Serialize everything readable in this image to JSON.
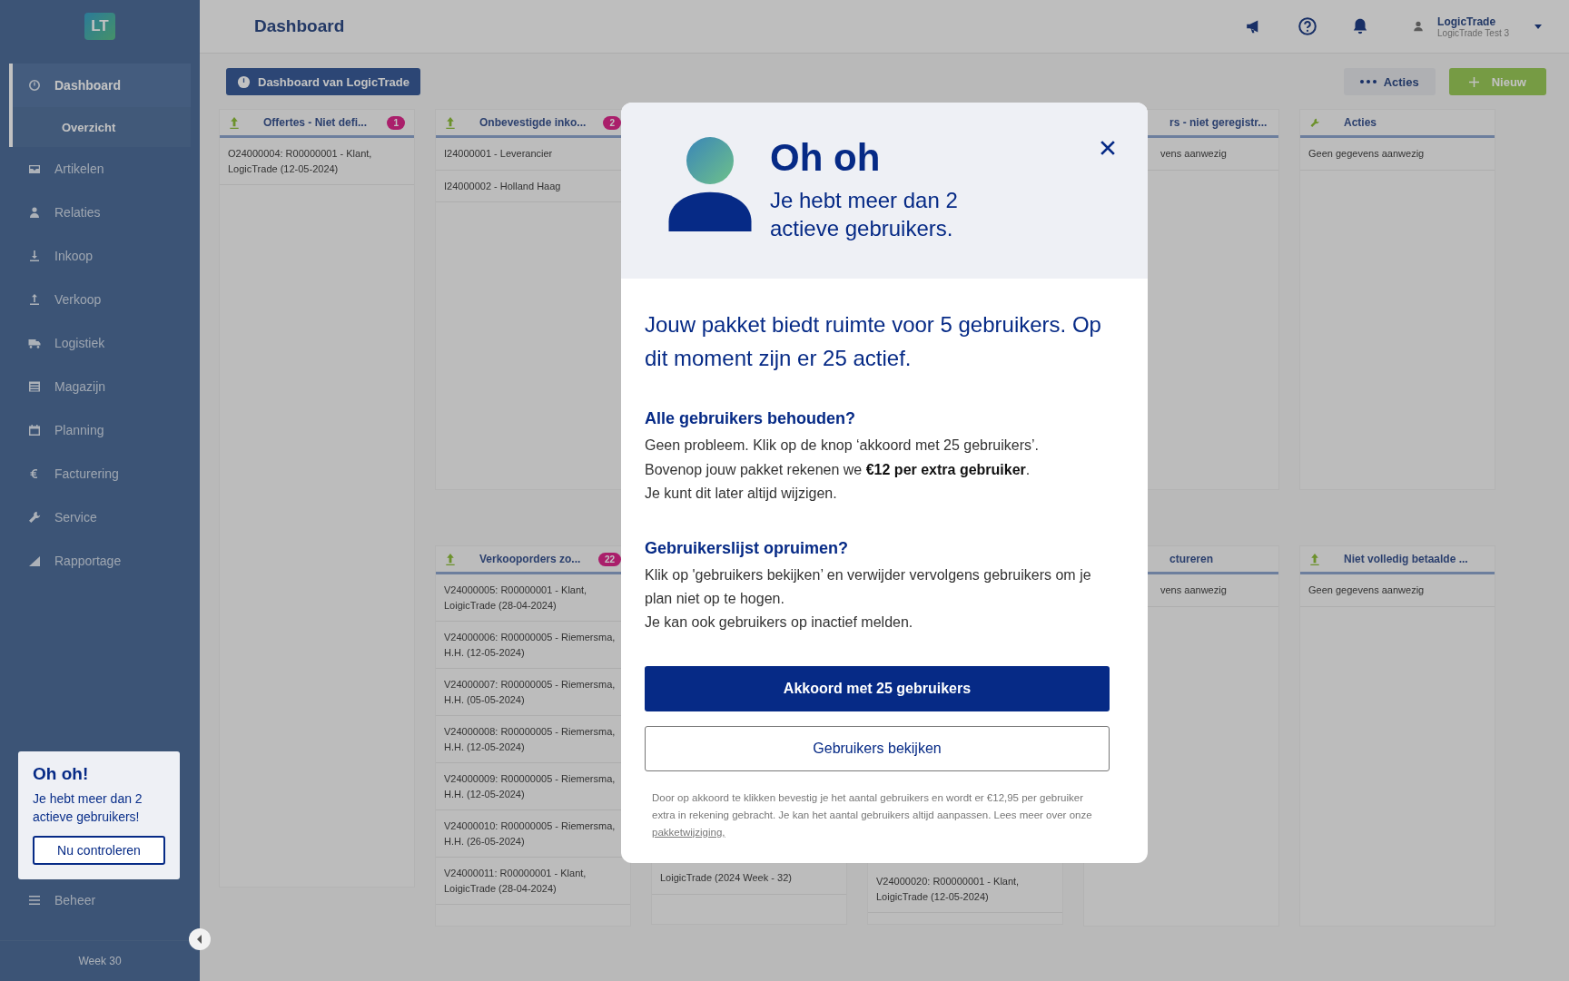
{
  "sidebar": {
    "logo": "LT",
    "items": [
      {
        "label": "Dashboard",
        "selected": true,
        "children": [
          {
            "label": "Overzicht",
            "selected": true
          }
        ]
      },
      {
        "label": "Artikelen",
        "selected": false
      },
      {
        "label": "Relaties",
        "selected": false
      },
      {
        "label": "Inkoop",
        "selected": false
      },
      {
        "label": "Verkoop",
        "selected": false
      },
      {
        "label": "Logistiek",
        "selected": false
      },
      {
        "label": "Magazijn",
        "selected": false
      },
      {
        "label": "Planning",
        "selected": false
      },
      {
        "label": "Facturering",
        "selected": false
      },
      {
        "label": "Service",
        "selected": false
      },
      {
        "label": "Rapportage",
        "selected": false
      }
    ],
    "footer_item": {
      "label": "Beheer",
      "selected": false
    },
    "week": "Week 30"
  },
  "header": {
    "title": "Dashboard",
    "user": {
      "name": "LogicTrade",
      "company": "LogicTrade Test 3"
    }
  },
  "toolbar": {
    "dashboard_button": "Dashboard van LogicTrade",
    "actions_button": "Acties",
    "new_button": "Nieuw"
  },
  "board": {
    "lanes": [
      {
        "cards": [
          {
            "kind": "arrow",
            "title": "Offertes - Niet defi...",
            "count": "1",
            "items": [
              "O24000004: R00000001 - Klant, LogicTrade (12-05-2024)"
            ]
          }
        ]
      },
      {
        "cards": [
          {
            "kind": "arrow",
            "title": "Onbevestigde inko...",
            "count": "2",
            "items": [
              "I24000001 - Leverancier",
              "I24000002 - Holland Haag"
            ]
          },
          {
            "kind": "arrow",
            "title": "Verkooporders zo...",
            "count": "22",
            "items": [
              "V24000005: R00000001 - Klant, LoigicTrade (28-04-2024)",
              "V24000006: R00000005 - Riemersma, H.H. (12-05-2024)",
              "V24000007: R00000005 - Riemersma, H.H. (05-05-2024)",
              "V24000008: R00000005 - Riemersma, H.H. (12-05-2024)",
              "V24000009: R00000005 - Riemersma, H.H. (12-05-2024)",
              "V24000010: R00000005 - Riemersma, H.H. (26-05-2024)",
              "V24000011: R00000001 - Klant, LoigicTrade (28-04-2024)"
            ]
          }
        ]
      },
      {
        "cards": [
          {
            "items": [
              "LoigicTrade (2024 Week - 32)"
            ]
          }
        ]
      },
      {
        "cards": [
          {
            "items": [
              "V24000020: R00000001 - Klant, LoigicTrade (12-05-2024)"
            ]
          }
        ]
      },
      {
        "cards": [
          {
            "title": "rs - niet geregistr...",
            "items": [
              "vens aanwezig"
            ]
          },
          {
            "title": "ctureren",
            "items": [
              "vens aanwezig"
            ]
          }
        ]
      },
      {
        "cards": [
          {
            "kind": "wrench",
            "title": "Acties",
            "items": [
              "Geen gegevens aanwezig"
            ]
          },
          {
            "kind": "arrow",
            "title": "Niet volledig betaalde ...",
            "items": [
              "Geen gegevens aanwezig"
            ]
          }
        ]
      }
    ]
  },
  "toast": {
    "title": "Oh oh!",
    "text": "Je hebt meer dan 2 actieve gebruikers!",
    "button": "Nu controleren"
  },
  "modal": {
    "title": "Oh oh",
    "subtitle": "Je hebt meer dan 2 actieve gebruikers.",
    "headline": "Jouw pakket biedt ruimte voor 5 gebruikers. Op dit moment zijn er 25 actief.",
    "sections": [
      {
        "heading": "Alle gebruikers behouden?",
        "lines": [
          "Geen probleem. Klik op de knop ‘akkoord met 25 gebruikers’.",
          "Bovenop jouw pakket rekenen we **€12 per extra gebruiker**.",
          "Je kunt dit later altijd wijzigen."
        ]
      },
      {
        "heading": "Gebruikerslijst opruimen?",
        "lines": [
          "Klik op 'gebruikers bekijken’ en verwijder vervolgens gebruikers om je plan niet op te hogen.",
          "Je kan ook gebruikers op inactief melden."
        ]
      }
    ],
    "primary_button": "Akkoord met 25 gebruikers",
    "secondary_button": "Gebruikers bekijken",
    "note": "Door op akkoord te klikken bevestig je het aantal gebruikers en wordt er €12,95 per gebruiker extra in rekening gebracht. Je kan het aantal gebruikers altijd aanpassen. Lees meer over onze ",
    "note_link": "pakketwijziging,"
  }
}
